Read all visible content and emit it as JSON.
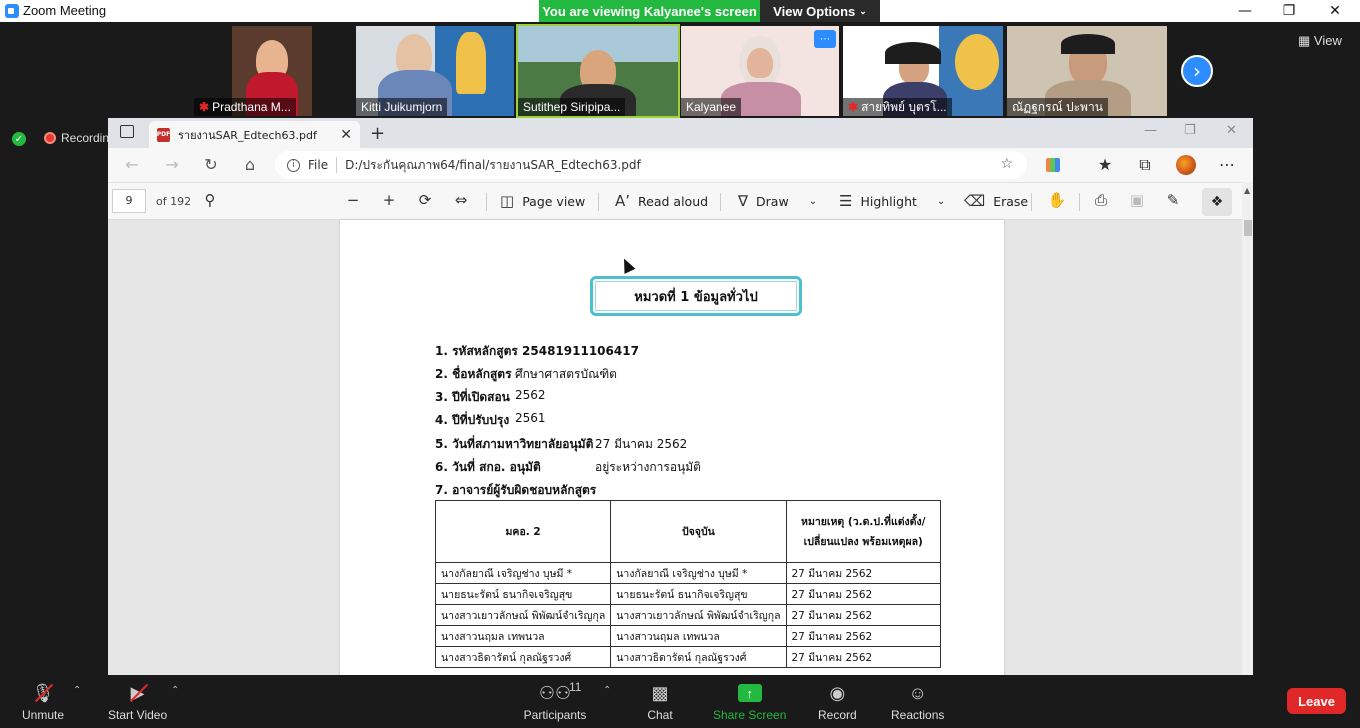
{
  "zoom": {
    "window_title": "Zoom Meeting",
    "viewing_banner": "You are viewing Kalyanee's screen",
    "view_options": "View Options",
    "view_button": "View",
    "recording": "Recordin",
    "participants": [
      {
        "name": "Pradthana M...",
        "muted": true
      },
      {
        "name": "Kitti Juikumjorn",
        "muted": false
      },
      {
        "name": "Sutithep Siripipa...",
        "muted": false
      },
      {
        "name": "Kalyanee",
        "muted": false
      },
      {
        "name": "สายทิพย์  บุตรโ...",
        "muted": true
      },
      {
        "name": "ณัฏฐกรณ์ ปะพาน",
        "muted": false
      }
    ],
    "controls": {
      "unmute": "Unmute",
      "start_video": "Start Video",
      "participants": "Participants",
      "participants_count": "11",
      "chat": "Chat",
      "share_screen": "Share Screen",
      "record": "Record",
      "reactions": "Reactions",
      "leave": "Leave"
    }
  },
  "browser": {
    "tab_title": "รายงานSAR_Edtech63.pdf",
    "address_scheme": "File",
    "address_url": "D:/ประกันคุณภาพ64/final/รายงานSAR_Edtech63.pdf",
    "pdf_toolbar": {
      "page_number": "9",
      "page_total": "of 192",
      "page_view": "Page view",
      "read_aloud": "Read aloud",
      "draw": "Draw",
      "highlight": "Highlight",
      "erase": "Erase"
    }
  },
  "document": {
    "chapter_title": "หมวดที่ 1 ข้อมูลทั่วไป",
    "info": [
      {
        "label": "1. รหัสหลักสูตร 25481911106417",
        "value": ""
      },
      {
        "label": "2. ชื่อหลักสูตร",
        "value": "ศึกษาศาสตรบัณฑิต"
      },
      {
        "label": "3. ปีที่เปิดสอน",
        "value": "2562"
      },
      {
        "label": "4. ปีที่ปรับปรุง",
        "value": "2561"
      },
      {
        "label": "5. วันที่สภามหาวิทยาลัยอนุมัติ",
        "value": "27 มีนาคม 2562"
      },
      {
        "label": "6. วันที่ สกอ. อนุมัติ",
        "value": "อยู่ระหว่างการอนุมัติ"
      },
      {
        "label": "7. อาจารย์ผู้รับผิดชอบหลักสูตร",
        "value": ""
      }
    ],
    "table": {
      "headers": [
        "มคอ. 2",
        "ปัจจุบัน",
        "หมายเหตุ (ว.ด.ป.ที่แต่งตั้ง/เปลี่ยนแปลง พร้อมเหตุผล)"
      ],
      "rows": [
        [
          "นางกัลยาณี เจริญช่าง  บุษมี *",
          "นางกัลยาณี เจริญช่าง  บุษมี *",
          "27 มีนาคม 2562"
        ],
        [
          "นายธนะรัตน์  ธนากิจเจริญสุข",
          "นายธนะรัตน์  ธนากิจเจริญสุข",
          "27 มีนาคม 2562"
        ],
        [
          "นางสาวเยาวลักษณ์ พิพัฒน์จำเริญกุล",
          "นางสาวเยาวลักษณ์ พิพัฒน์จำเริญกุล",
          "27 มีนาคม 2562"
        ],
        [
          "นางสาวนฤมล  เทพนวล",
          "นางสาวนฤมล  เทพนวล",
          "27 มีนาคม 2562"
        ],
        [
          "นางสาวธิดารัตน์  กุลณัฐรวงศ์",
          "นางสาวธิดารัตน์  กุลณัฐรวงศ์",
          "27 มีนาคม 2562"
        ]
      ]
    }
  }
}
